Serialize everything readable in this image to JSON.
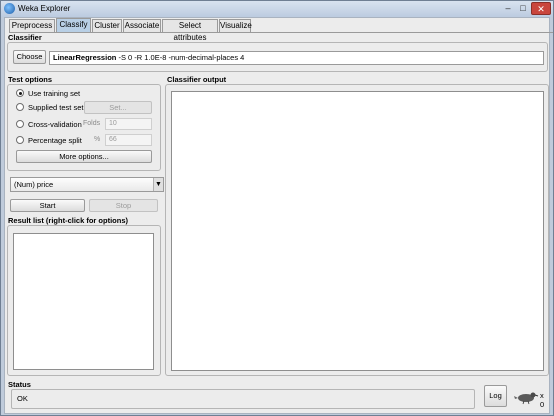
{
  "window": {
    "title": "Weka Explorer"
  },
  "tabs": [
    "Preprocess",
    "Classify",
    "Cluster",
    "Associate",
    "Select attributes",
    "Visualize"
  ],
  "classifier": {
    "section_title": "Classifier",
    "choose_label": "Choose",
    "name": "LinearRegression",
    "options": " -S 0 -R 1.0E-8 -num-decimal-places 4"
  },
  "test_options": {
    "section_title": "Test options",
    "use_training_set": "Use training set",
    "supplied_test_set": "Supplied test set",
    "set_button": "Set...",
    "cross_validation": "Cross-validation",
    "folds_label": "Folds",
    "folds_value": "10",
    "percentage_split": "Percentage split",
    "percent_label": "%",
    "percent_value": "66",
    "more_options": "More options..."
  },
  "class_selector": {
    "value": "(Num) price"
  },
  "actions": {
    "start": "Start",
    "stop": "Stop"
  },
  "result_list": {
    "title": "Result list (right-click for options)"
  },
  "classifier_output": {
    "title": "Classifier output"
  },
  "status": {
    "title": "Status",
    "text": "OK",
    "log_button": "Log",
    "count": "x 0"
  }
}
